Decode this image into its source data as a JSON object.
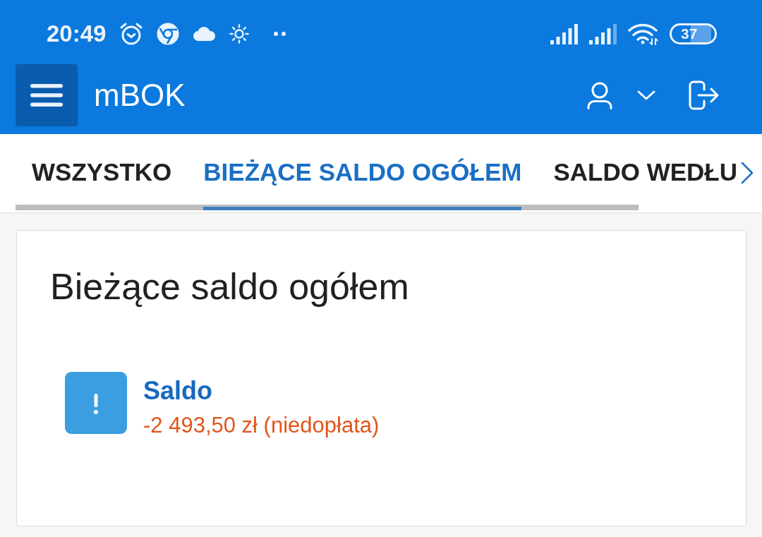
{
  "status_bar": {
    "time": "20:49",
    "battery": "37"
  },
  "app_bar": {
    "title": "mBOK"
  },
  "tabs": [
    {
      "label": "WSZYSTKO",
      "selected": false
    },
    {
      "label": "BIEŻĄCE SALDO OGÓŁEM",
      "selected": true
    },
    {
      "label": "SALDO WEDŁU",
      "selected": false
    }
  ],
  "card": {
    "title": "Bieżące saldo ogółem",
    "items": [
      {
        "label": "Saldo",
        "value": "-2 493,50 zł (niedopłata)"
      }
    ]
  }
}
